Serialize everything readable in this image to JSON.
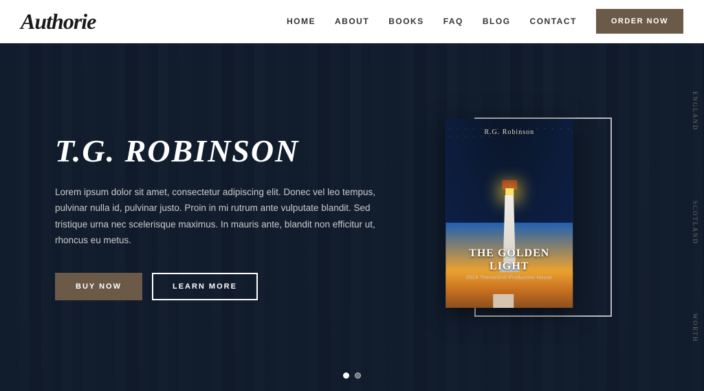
{
  "header": {
    "logo": "Authorie",
    "nav": {
      "items": [
        {
          "label": "HOME",
          "id": "home"
        },
        {
          "label": "ABOUT",
          "id": "about"
        },
        {
          "label": "BOOKS",
          "id": "books"
        },
        {
          "label": "FAQ",
          "id": "faq"
        },
        {
          "label": "BLOG",
          "id": "blog"
        },
        {
          "label": "CONTACT",
          "id": "contact"
        }
      ],
      "cta_label": "ORDER NOW"
    }
  },
  "hero": {
    "title": "T.G. ROBINSON",
    "description": "Lorem ipsum dolor sit amet, consectetur adipiscing elit. Donec vel leo tempus, pulvinar nulla id, pulvinar justo. Proin in mi rutrum ante vulputate blandit. Sed tristique urna nec scelerisque maximus. In mauris ante, blandit non efficitur ut, rhoncus eu metus.",
    "btn_buy": "BUY NOW",
    "btn_learn": "LEARN MORE",
    "book": {
      "author": "R.G. Robinson",
      "title": "THE GOLDEN LIGHT",
      "subtitle": "2019 ThemeGrill Production House"
    },
    "carousel": {
      "dots": [
        {
          "active": true
        },
        {
          "active": false
        }
      ]
    }
  },
  "side_texts": [
    "ENGLAND",
    "SCOTLAND",
    "WORTH"
  ]
}
